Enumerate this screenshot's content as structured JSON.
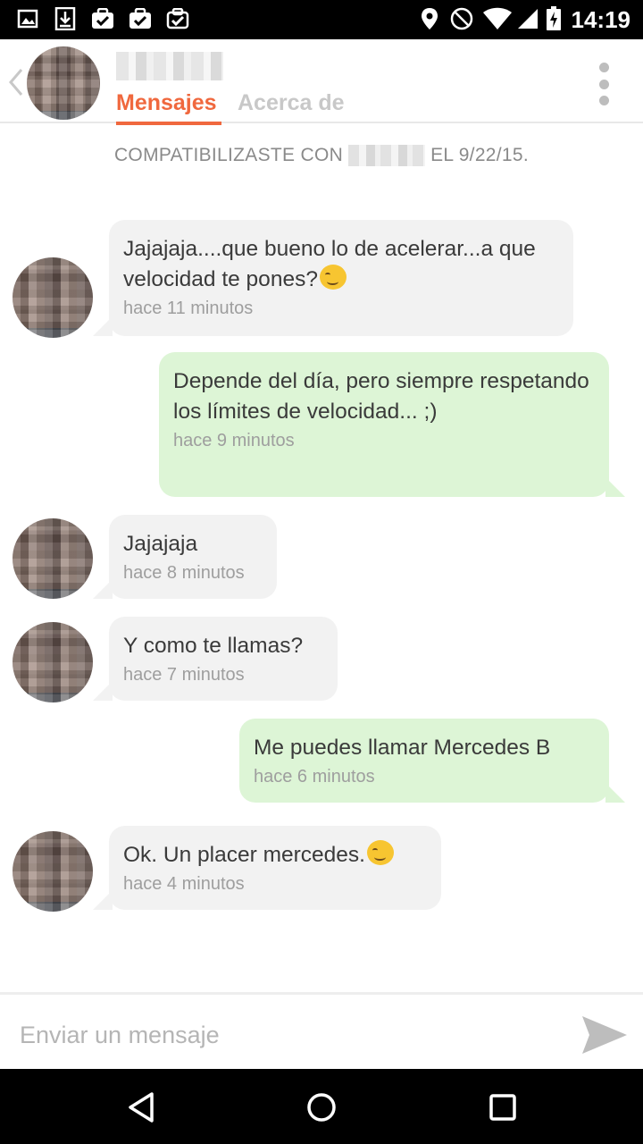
{
  "status_bar": {
    "time": "14:19",
    "left_icons": [
      "image-icon",
      "download-icon",
      "task-check-icon",
      "task-check-icon",
      "task-check-icon"
    ],
    "right_icons": [
      "location-icon",
      "do-not-disturb-icon",
      "wifi-icon",
      "signal-icon",
      "battery-charging-icon"
    ]
  },
  "header": {
    "tabs": [
      {
        "label": "Mensajes",
        "active": true
      },
      {
        "label": "Acerca de",
        "active": false
      }
    ],
    "accent_color": "#f0683e"
  },
  "match_banner": {
    "prefix": "COMPATIBILIZASTE CON",
    "suffix": "EL 9/22/15."
  },
  "messages": [
    {
      "direction": "incoming",
      "text": "Jajajaja....que bueno lo de acelerar...a que velocidad te pones?",
      "emoji": "wink-smile",
      "time": "hace 11 minutos"
    },
    {
      "direction": "outgoing",
      "text": "Depende del día, pero siempre respetando los límites de velocidad... ;)",
      "time": "hace 9 minutos"
    },
    {
      "direction": "incoming",
      "text": "Jajajaja",
      "time": "hace 8 minutos"
    },
    {
      "direction": "incoming",
      "text": "Y como te llamas?",
      "time": "hace 7 minutos"
    },
    {
      "direction": "outgoing",
      "text": "Me puedes llamar Mercedes B",
      "time": "hace 6 minutos"
    },
    {
      "direction": "incoming",
      "text": "Ok. Un placer mercedes.",
      "emoji": "wink-smile",
      "time": "hace 4 minutos"
    }
  ],
  "composer": {
    "placeholder": "Enviar un mensaje",
    "value": ""
  },
  "colors": {
    "incoming_bubble": "#f2f2f2",
    "outgoing_bubble": "#ddf5d6"
  }
}
